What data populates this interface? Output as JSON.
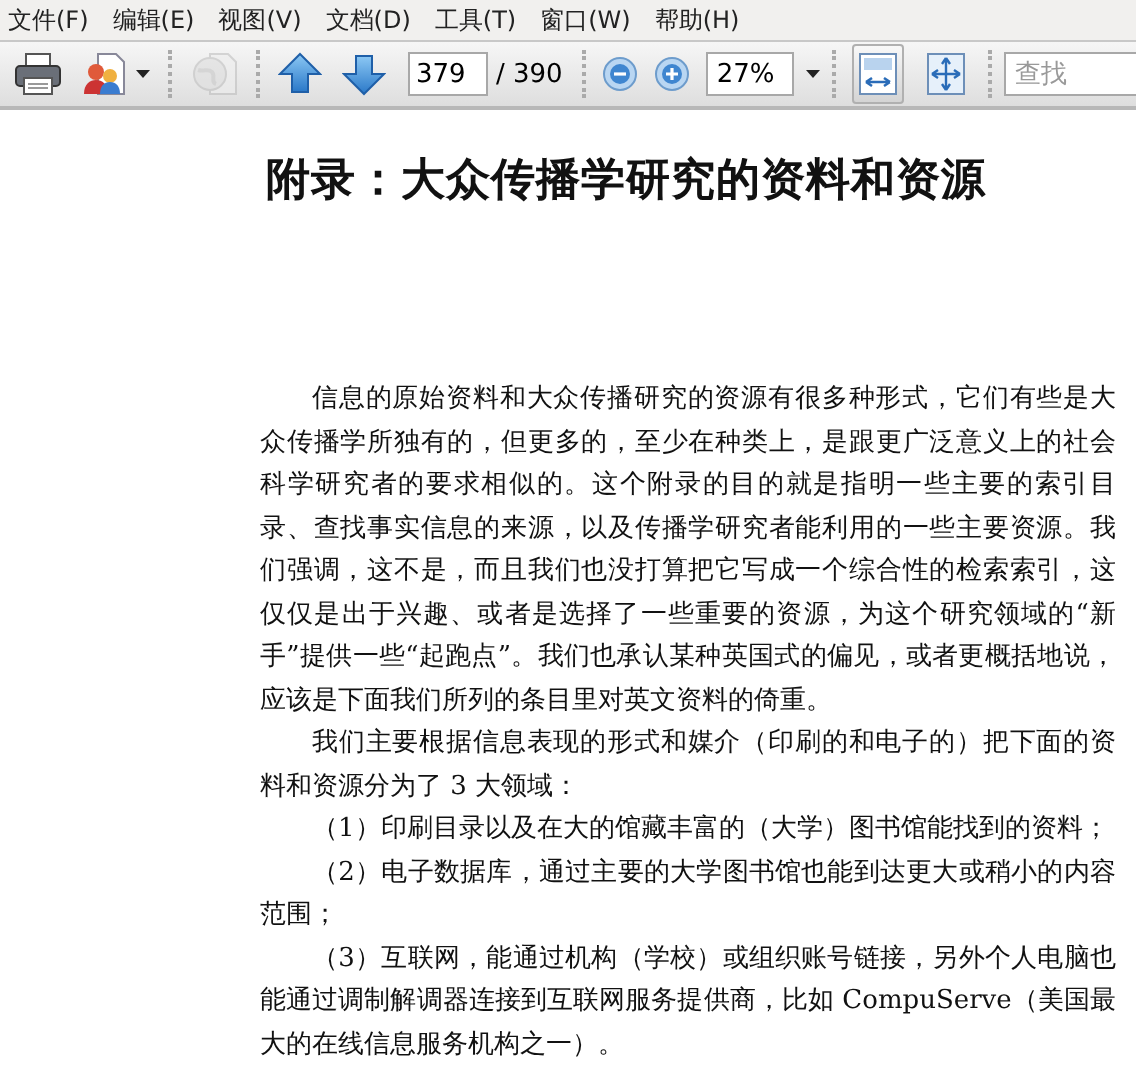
{
  "menu": [
    {
      "label": "文件(F)"
    },
    {
      "label": "编辑(E)"
    },
    {
      "label": "视图(V)"
    },
    {
      "label": "文档(D)"
    },
    {
      "label": "工具(T)"
    },
    {
      "label": "窗口(W)"
    },
    {
      "label": "帮助(H)"
    }
  ],
  "toolbar": {
    "tools": [
      {
        "disabled": false
      },
      {
        "disabled": false
      },
      {
        "disabled": true
      }
    ],
    "page": {
      "value": "379",
      "total": "/ 390"
    },
    "zoom": {
      "value": "27%"
    },
    "views": [
      {
        "selected": true
      },
      {
        "selected": false
      }
    ],
    "search": {
      "placeholder": "查找"
    }
  },
  "document": {
    "title": "附录：大众传播学研究的资料和资源",
    "paragraphs": [
      "信息的原始资料和大众传播研究的资源有很多种形式，它们有些是大众传播学所独有的，但更多的，至少在种类上，是跟更广泛意义上的社会科学研究者的要求相似的。这个附录的目的就是指明一些主要的索引目录、查找事实信息的来源，以及传播学研究者能利用的一些主要资源。我们强调，这不是，而且我们也没打算把它写成一个综合性的检索索引，这仅仅是出于兴趣、或者是选择了一些重要的资源，为这个研究领域的“新手”提供一些“起跑点”。我们也承认某种英国式的偏见，或者更概括地说，应该是下面我们所列的条目里对英文资料的倚重。",
      "我们主要根据信息表现的形式和媒介（印刷的和电子的）把下面的资料和资源分为了 3 大领域：",
      "（1）印刷目录以及在大的馆藏丰富的（大学）图书馆能找到的资料；",
      "（2）电子数据库，通过主要的大学图书馆也能到达更大或稍小的内容范围；",
      "（3）互联网，能通过机构（学校）或组织账号链接，另外个人电脑也能通过调制解调器连接到互联网服务提供商，比如 CompuServe（美国最大的在线信息服务机构之一）。"
    ]
  }
}
